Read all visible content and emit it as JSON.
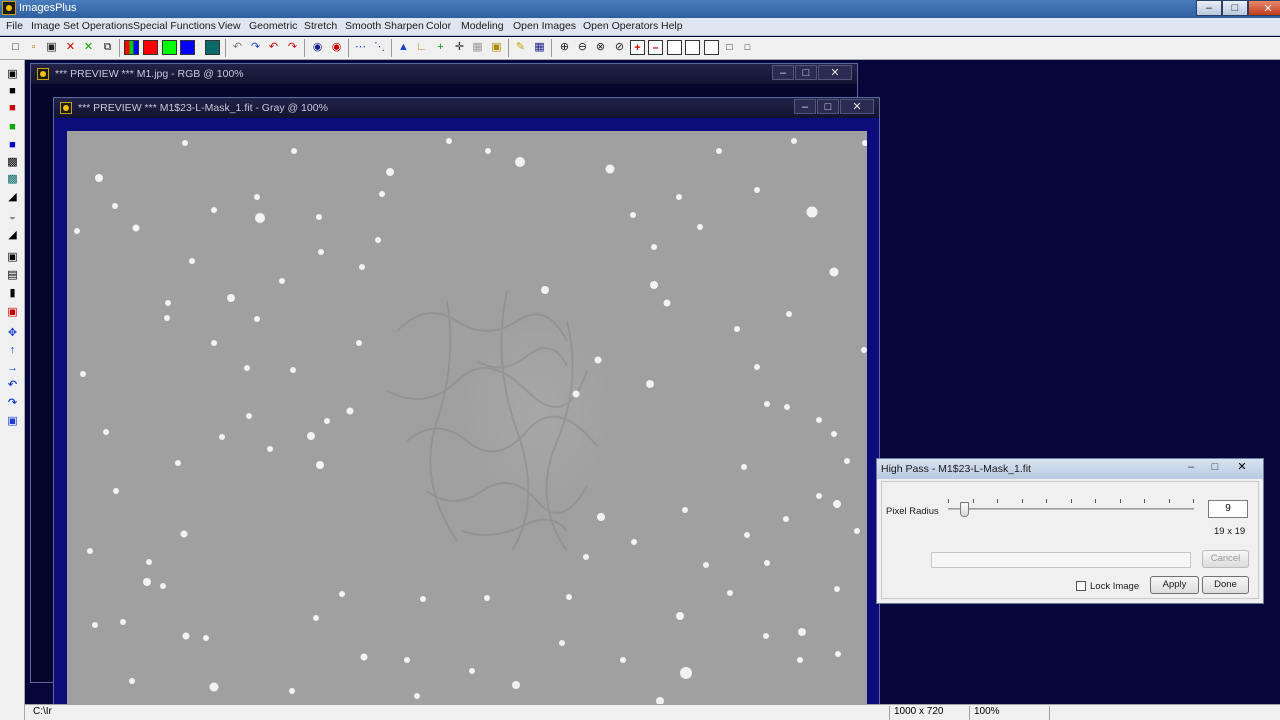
{
  "app": {
    "title": "ImagesPlus"
  },
  "menu": [
    "File",
    "Image Set Operations",
    "Special Functions",
    "View",
    "Geometric",
    "Stretch",
    "Smooth Sharpen",
    "Color",
    "Modeling",
    "Open Images",
    "Open Operators",
    "Help"
  ],
  "window_back": {
    "title": "*** PREVIEW *** M1.jpg - RGB @ 100%"
  },
  "window_front": {
    "title": "*** PREVIEW *** M1$23-L-Mask_1.fit - Gray @ 100%"
  },
  "dialog": {
    "title": "High Pass - M1$23-L-Mask_1.fit",
    "pixel_radius_label": "Pixel Radius",
    "pixel_radius_value": "9",
    "pixel_radius_fraction": 0.05,
    "kernel_size": "19 x 19",
    "lock_image_label": "Lock Image",
    "lock_image_checked": false,
    "cancel_label": "Cancel",
    "apply_label": "Apply",
    "done_label": "Done"
  },
  "status": {
    "path": "C:\\Ir",
    "size": "1000 x 720",
    "zoom": "100%"
  },
  "colors": {
    "desktop": "#06063a",
    "image_border": "#0c0c7a",
    "image_bg": "#a0a0a0"
  }
}
